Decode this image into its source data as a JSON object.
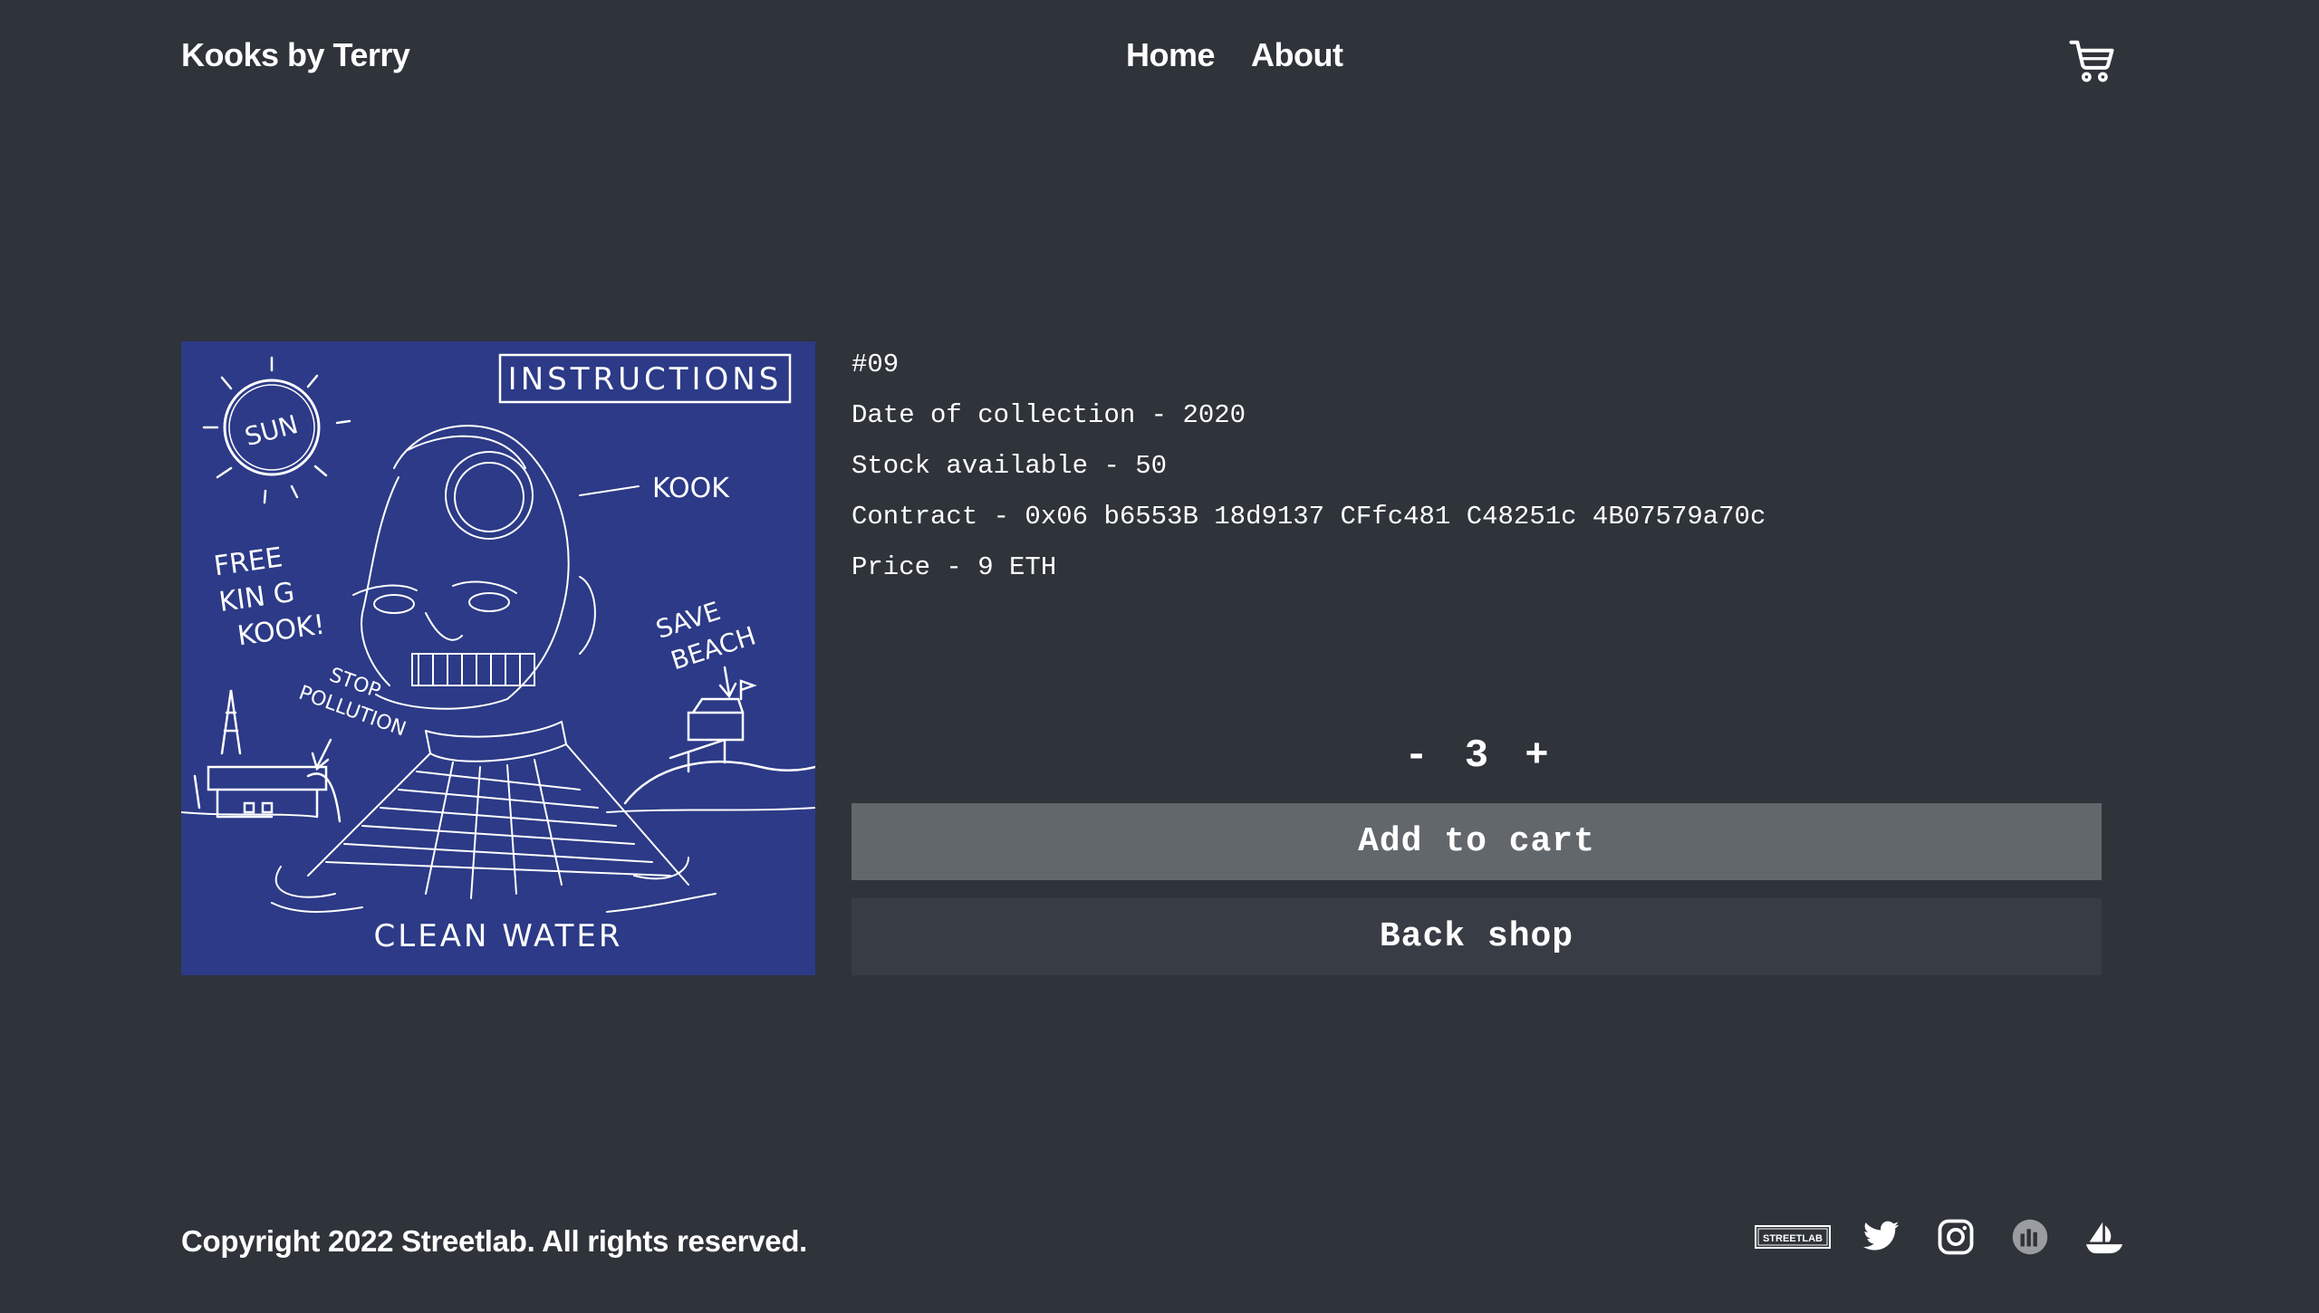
{
  "header": {
    "brand": "Kooks by Terry",
    "nav": [
      {
        "label": "Home"
      },
      {
        "label": "About"
      }
    ],
    "cart_icon": "shopping-cart-icon"
  },
  "product": {
    "image_alt": "Kooks artwork #09",
    "artwork_text": {
      "instructions": "INSTRUCTIONS",
      "sun": "SUN",
      "kook": "KOOK",
      "free_king": [
        "FREE",
        "KIN G",
        "KOOK!"
      ],
      "save_beach": [
        "SAVE",
        "BEACH"
      ],
      "stop_pollution": [
        "STOP",
        "POLLUTION"
      ],
      "clean_water": "CLEAN WATER"
    },
    "id": "#09",
    "date_line": "Date of collection - 2020",
    "stock_line": "Stock available - 50",
    "contract_line": "Contract - 0x06 b6553B 18d9137 CFfc481 C48251c 4B07579a70c",
    "price_line": "Price - 9 ETH",
    "colors": {
      "artwork_bg": "#2c3a87"
    }
  },
  "quantity": {
    "minus": "-",
    "value": "3",
    "plus": "+"
  },
  "actions": {
    "add_to_cart": "Add to cart",
    "back_shop": "Back shop"
  },
  "footer": {
    "copyright": "Copyright 2022 Streetlab. All rights reserved.",
    "streetlab_logo_text": "STREETLAB",
    "social_icons": [
      "streetlab-logo-icon",
      "twitter-icon",
      "instagram-icon",
      "chart-logo-icon",
      "opensea-boat-icon"
    ]
  },
  "colors": {
    "background": "#2f333a",
    "add_button": "#62676c",
    "back_button": "#383c44",
    "text": "#ffffff"
  }
}
